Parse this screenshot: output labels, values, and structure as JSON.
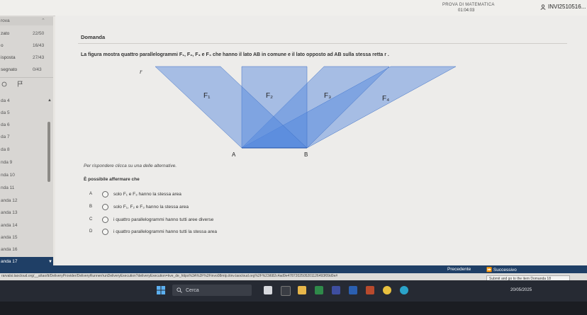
{
  "header": {
    "exam_title": "PROVA DI MATEMATICA",
    "timer": "01:04:03",
    "user": "INVI2510516..."
  },
  "sidebar": {
    "top_label": "rova",
    "stats": [
      {
        "label": "zato",
        "value": "22/50"
      },
      {
        "label": "o",
        "value": "16/43"
      },
      {
        "label": "isposta",
        "value": "27/43"
      },
      {
        "label": "segnato",
        "value": "0/43"
      }
    ],
    "items": [
      {
        "label": "da 4"
      },
      {
        "label": "da 5"
      },
      {
        "label": "da 6"
      },
      {
        "label": "da 7"
      },
      {
        "label": "da 8"
      },
      {
        "label": "nda 9"
      },
      {
        "label": "nda 10"
      },
      {
        "label": "nda 11"
      },
      {
        "label": "anda 12"
      },
      {
        "label": "anda 13"
      },
      {
        "label": "anda 14"
      },
      {
        "label": "anda 15"
      },
      {
        "label": "anda 16"
      },
      {
        "label": "anda 17"
      }
    ]
  },
  "question": {
    "title": "Domanda",
    "text": "La figura mostra quattro parallelogrammi F₁, F₂, F₃ e F₄ che hanno il lato AB in comune e il lato opposto ad AB sulla stessa retta r .",
    "figure": {
      "label_r": "r",
      "label_A": "A",
      "label_B": "B",
      "labels_F": [
        "F₁",
        "F₂",
        "F₃",
        "F₄"
      ]
    },
    "instruction": "Per rispondere clicca su una delle alternative.",
    "prompt": "È possibile affermare che",
    "options": [
      {
        "letter": "A",
        "text": "solo F₁ e F₃ hanno la stessa area"
      },
      {
        "letter": "B",
        "text": "solo F₁, F₂ e F₃ hanno la stessa area"
      },
      {
        "letter": "C",
        "text": "i quattro parallelogrammi hanno tutti aree diverse"
      },
      {
        "letter": "D",
        "text": "i quattro parallelogrammi hanno tutti la stessa area"
      }
    ]
  },
  "nav": {
    "prev_label": "Precedente",
    "next_label": "Successivo"
  },
  "status": {
    "url": "rarvalsi.taocloud.org/__a/tao/tt/DeliveryProvider/DeliveryRunner/runDeliveryExecution?deliveryExecution=kve_de_https%3A%2F%2Finvo08mtp.itinv.taocloud.org%2F%23i682c4ad9e4787202505201126493f09d0e#",
    "tooltip": "Submit and go to the item Domanda 18"
  },
  "taskbar": {
    "search_placeholder": "Cerca",
    "date": "20/05/2025"
  },
  "colors": {
    "nav_blue": "#1f3f66",
    "shape_blue": "#4a7fd8",
    "taskbar": "#262a33"
  }
}
